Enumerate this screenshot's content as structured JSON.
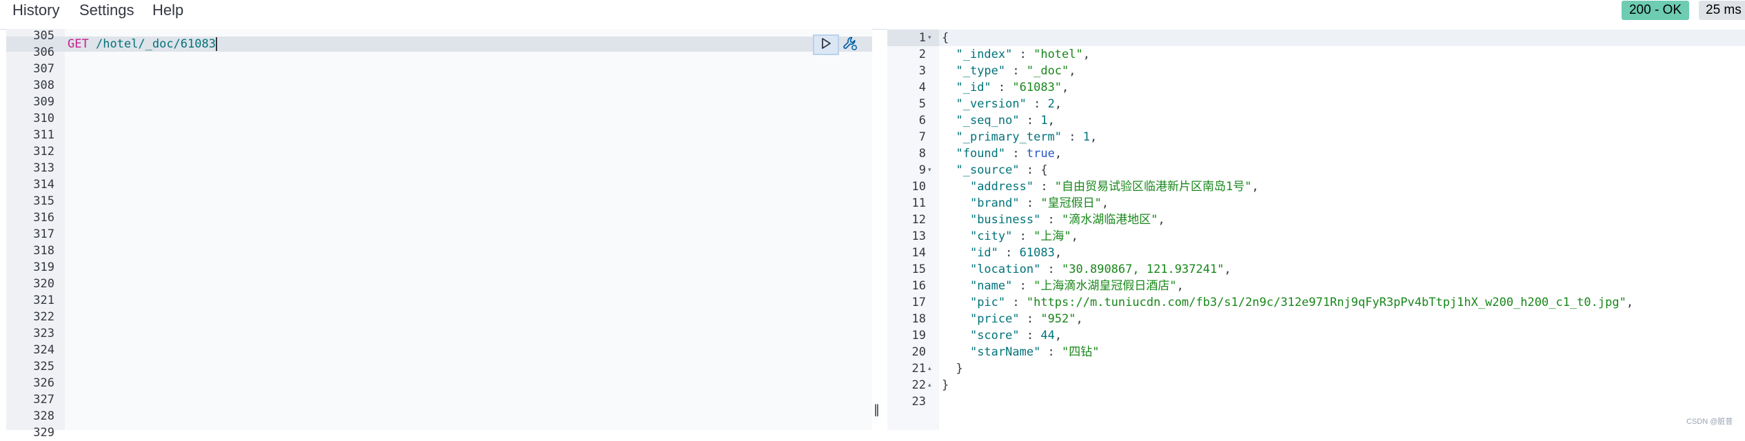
{
  "menu": {
    "items": [
      "History",
      "Settings",
      "Help"
    ]
  },
  "status": {
    "code_text": "200 - OK",
    "time_text": "25 ms",
    "ok_color": "#6dccb1"
  },
  "request": {
    "line_numbers": [
      "305",
      "306",
      "307",
      "308",
      "309",
      "310",
      "311",
      "312",
      "313",
      "314",
      "315",
      "316",
      "317",
      "318",
      "319",
      "320",
      "321",
      "322",
      "323",
      "324",
      "325",
      "326",
      "327",
      "328",
      "329"
    ],
    "method": "GET",
    "url": "/hotel/_doc/61083",
    "run_icon": "play-icon",
    "wrench_icon": "wrench-icon"
  },
  "response": {
    "line_numbers": [
      "1",
      "2",
      "3",
      "4",
      "5",
      "6",
      "7",
      "8",
      "9",
      "10",
      "11",
      "12",
      "13",
      "14",
      "15",
      "16",
      "17",
      "18",
      "19",
      "20",
      "21",
      "22",
      "23"
    ],
    "fold_marks": [
      "▾",
      "",
      "",
      "",
      "",
      "",
      "",
      "",
      "▾",
      "",
      "",
      "",
      "",
      "",
      "",
      "",
      "",
      "",
      "",
      "",
      "▴",
      "▴",
      ""
    ],
    "lines": [
      [
        {
          "t": "p",
          "v": "{"
        }
      ],
      [
        {
          "t": "p",
          "v": "  "
        },
        {
          "t": "k",
          "v": "\"_index\""
        },
        {
          "t": "p",
          "v": " : "
        },
        {
          "t": "s",
          "v": "\"hotel\""
        },
        {
          "t": "p",
          "v": ","
        }
      ],
      [
        {
          "t": "p",
          "v": "  "
        },
        {
          "t": "k",
          "v": "\"_type\""
        },
        {
          "t": "p",
          "v": " : "
        },
        {
          "t": "s",
          "v": "\"_doc\""
        },
        {
          "t": "p",
          "v": ","
        }
      ],
      [
        {
          "t": "p",
          "v": "  "
        },
        {
          "t": "k",
          "v": "\"_id\""
        },
        {
          "t": "p",
          "v": " : "
        },
        {
          "t": "s",
          "v": "\"61083\""
        },
        {
          "t": "p",
          "v": ","
        }
      ],
      [
        {
          "t": "p",
          "v": "  "
        },
        {
          "t": "k",
          "v": "\"_version\""
        },
        {
          "t": "p",
          "v": " : "
        },
        {
          "t": "n",
          "v": "2"
        },
        {
          "t": "p",
          "v": ","
        }
      ],
      [
        {
          "t": "p",
          "v": "  "
        },
        {
          "t": "k",
          "v": "\"_seq_no\""
        },
        {
          "t": "p",
          "v": " : "
        },
        {
          "t": "n",
          "v": "1"
        },
        {
          "t": "p",
          "v": ","
        }
      ],
      [
        {
          "t": "p",
          "v": "  "
        },
        {
          "t": "k",
          "v": "\"_primary_term\""
        },
        {
          "t": "p",
          "v": " : "
        },
        {
          "t": "n",
          "v": "1"
        },
        {
          "t": "p",
          "v": ","
        }
      ],
      [
        {
          "t": "p",
          "v": "  "
        },
        {
          "t": "k",
          "v": "\"found\""
        },
        {
          "t": "p",
          "v": " : "
        },
        {
          "t": "b",
          "v": "true"
        },
        {
          "t": "p",
          "v": ","
        }
      ],
      [
        {
          "t": "p",
          "v": "  "
        },
        {
          "t": "k",
          "v": "\"_source\""
        },
        {
          "t": "p",
          "v": " : {"
        }
      ],
      [
        {
          "t": "p",
          "v": "    "
        },
        {
          "t": "k",
          "v": "\"address\""
        },
        {
          "t": "p",
          "v": " : "
        },
        {
          "t": "s",
          "v": "\"自由贸易试验区临港新片区南岛1号\""
        },
        {
          "t": "p",
          "v": ","
        }
      ],
      [
        {
          "t": "p",
          "v": "    "
        },
        {
          "t": "k",
          "v": "\"brand\""
        },
        {
          "t": "p",
          "v": " : "
        },
        {
          "t": "s",
          "v": "\"皇冠假日\""
        },
        {
          "t": "p",
          "v": ","
        }
      ],
      [
        {
          "t": "p",
          "v": "    "
        },
        {
          "t": "k",
          "v": "\"business\""
        },
        {
          "t": "p",
          "v": " : "
        },
        {
          "t": "s",
          "v": "\"滴水湖临港地区\""
        },
        {
          "t": "p",
          "v": ","
        }
      ],
      [
        {
          "t": "p",
          "v": "    "
        },
        {
          "t": "k",
          "v": "\"city\""
        },
        {
          "t": "p",
          "v": " : "
        },
        {
          "t": "s",
          "v": "\"上海\""
        },
        {
          "t": "p",
          "v": ","
        }
      ],
      [
        {
          "t": "p",
          "v": "    "
        },
        {
          "t": "k",
          "v": "\"id\""
        },
        {
          "t": "p",
          "v": " : "
        },
        {
          "t": "n",
          "v": "61083"
        },
        {
          "t": "p",
          "v": ","
        }
      ],
      [
        {
          "t": "p",
          "v": "    "
        },
        {
          "t": "k",
          "v": "\"location\""
        },
        {
          "t": "p",
          "v": " : "
        },
        {
          "t": "s",
          "v": "\"30.890867, 121.937241\""
        },
        {
          "t": "p",
          "v": ","
        }
      ],
      [
        {
          "t": "p",
          "v": "    "
        },
        {
          "t": "k",
          "v": "\"name\""
        },
        {
          "t": "p",
          "v": " : "
        },
        {
          "t": "s",
          "v": "\"上海滴水湖皇冠假日酒店\""
        },
        {
          "t": "p",
          "v": ","
        }
      ],
      [
        {
          "t": "p",
          "v": "    "
        },
        {
          "t": "k",
          "v": "\"pic\""
        },
        {
          "t": "p",
          "v": " : "
        },
        {
          "t": "s",
          "v": "\"https://m.tuniucdn.com/fb3/s1/2n9c/312e971Rnj9qFyR3pPv4bTtpj1hX_w200_h200_c1_t0.jpg\""
        },
        {
          "t": "p",
          "v": ","
        }
      ],
      [
        {
          "t": "p",
          "v": "    "
        },
        {
          "t": "k",
          "v": "\"price\""
        },
        {
          "t": "p",
          "v": " : "
        },
        {
          "t": "s",
          "v": "\"952\""
        },
        {
          "t": "p",
          "v": ","
        }
      ],
      [
        {
          "t": "p",
          "v": "    "
        },
        {
          "t": "k",
          "v": "\"score\""
        },
        {
          "t": "p",
          "v": " : "
        },
        {
          "t": "n",
          "v": "44"
        },
        {
          "t": "p",
          "v": ","
        }
      ],
      [
        {
          "t": "p",
          "v": "    "
        },
        {
          "t": "k",
          "v": "\"starName\""
        },
        {
          "t": "p",
          "v": " : "
        },
        {
          "t": "s",
          "v": "\"四钻\""
        }
      ],
      [
        {
          "t": "p",
          "v": "  }"
        }
      ],
      [
        {
          "t": "p",
          "v": "}"
        }
      ],
      []
    ]
  },
  "watermark": "CSDN @脏昔"
}
